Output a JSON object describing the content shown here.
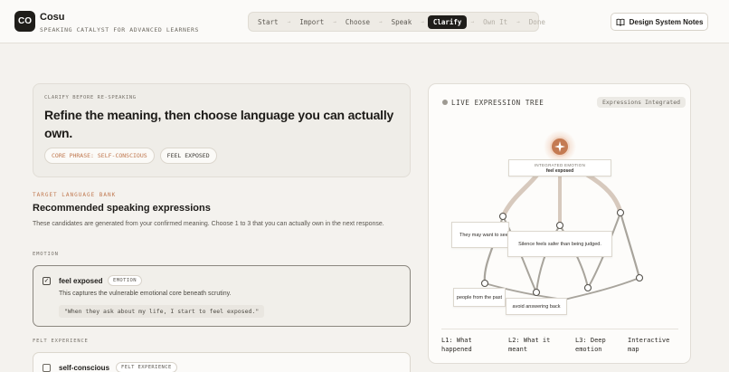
{
  "app": {
    "logo": "CO",
    "name": "Cosu",
    "tagline": "SPEAKING CATALYST FOR ADVANCED LEARNERS"
  },
  "steps": [
    {
      "label": "Start",
      "state": "done"
    },
    {
      "label": "Import",
      "state": "done"
    },
    {
      "label": "Choose",
      "state": "done"
    },
    {
      "label": "Speak",
      "state": "done"
    },
    {
      "label": "Clarify",
      "state": "active"
    },
    {
      "label": "Own It",
      "state": "upcoming"
    },
    {
      "label": "Done",
      "state": "upcoming"
    }
  ],
  "header": {
    "notes_button": "Design System Notes"
  },
  "clarify": {
    "eyebrow": "CLARIFY BEFORE RE-SPEAKING",
    "title": "Refine the meaning, then choose language you can actually own.",
    "core_chip": "CORE PHRASE: SELF-CONSCIOUS",
    "feel_chip": "FEEL EXPOSED"
  },
  "bank": {
    "eyebrow": "TARGET LANGUAGE BANK",
    "title": "Recommended speaking expressions",
    "description": "These candidates are generated from your confirmed meaning. Choose 1 to 3 that you can actually own in the next response."
  },
  "groups": [
    {
      "label": "EMOTION",
      "candidate": {
        "title": "feel exposed",
        "tag": "EMOTION",
        "checked": true,
        "description": "This captures the vulnerable emotional core beneath scrutiny.",
        "example": "\"When they ask about my life, I start to feel exposed.\""
      }
    },
    {
      "label": "FELT EXPERIENCE",
      "candidate": {
        "title": "self-conscious",
        "tag": "FELT EXPERIENCE",
        "checked": false
      }
    }
  ],
  "tree": {
    "title": "LIVE EXPRESSION TREE",
    "badge": "Expressions Integrated",
    "root_label": "INTEGRATED EMOTION",
    "root_text": "feel exposed",
    "nodes": {
      "left": "They may want to see",
      "center": "Silence feels safer than being judged.",
      "bottom_left": "people from the past",
      "bottom_center": "avoid answering back"
    },
    "legend": [
      "L1: What happened",
      "L2: What it meant",
      "L3: Deep emotion",
      "Interactive map"
    ]
  },
  "colors": {
    "accent": "#c0784f",
    "active_step": "#1f1d1a",
    "background": "#f4f2ee"
  }
}
